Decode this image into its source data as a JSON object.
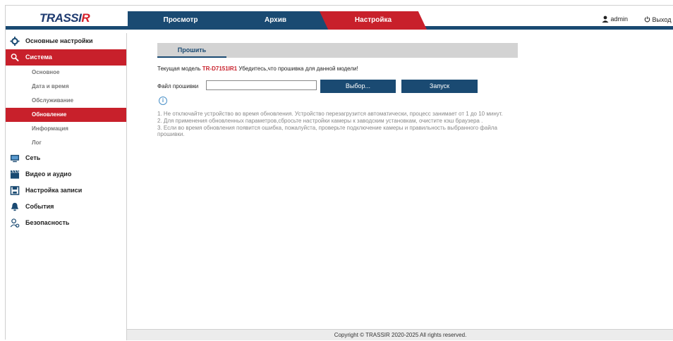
{
  "header": {
    "logo_main": "TRASSI",
    "logo_accent": "R",
    "tabs": [
      {
        "label": "Просмотр"
      },
      {
        "label": "Архив"
      },
      {
        "label": "Настройка"
      }
    ],
    "user": "admin",
    "logout": "Выход"
  },
  "sidebar": {
    "items": [
      {
        "label": "Основные настройки",
        "icon": "gear-icon"
      },
      {
        "label": "Система",
        "icon": "system-icon"
      },
      {
        "label": "Сеть",
        "icon": "network-icon"
      },
      {
        "label": "Видео и аудио",
        "icon": "video-icon"
      },
      {
        "label": "Настройка записи",
        "icon": "record-icon"
      },
      {
        "label": "События",
        "icon": "events-icon"
      },
      {
        "label": "Безопасность",
        "icon": "security-icon"
      }
    ],
    "system_sub": [
      {
        "label": "Основное"
      },
      {
        "label": "Дата и время"
      },
      {
        "label": "Обслуживание"
      },
      {
        "label": "Обновление"
      },
      {
        "label": "Информация"
      },
      {
        "label": "Лог"
      }
    ]
  },
  "main": {
    "subtab": "Прошить",
    "model_prefix": "Текущая модель",
    "model": "TR-D7151IR1",
    "model_suffix": "Убедитесь,что прошивка для данной модели!",
    "file_label": "Файл прошивки",
    "file_value": "",
    "select_button": "Выбор...",
    "start_button": "Запуск",
    "info_glyph": "i",
    "notes": [
      "1. Не отключайте устройство во время обновления. Устройство перезагрузится автоматически, процесс занимает от 1 до 10 минут.",
      "2. Для применения обновленных параметров,сбросьте настройки камеры к заводским установкам, очистите кэш браузера .",
      "3. Если во время обновления появится ошибка, пожалуйста, проверьте подключение камеры и правильность выбранного файла прошивки."
    ]
  },
  "footer": {
    "copyright": "Copyright © TRASSIR 2020-2025 All rights reserved."
  },
  "colors": {
    "brand_blue": "#1a4a72",
    "brand_red": "#c8202b"
  }
}
